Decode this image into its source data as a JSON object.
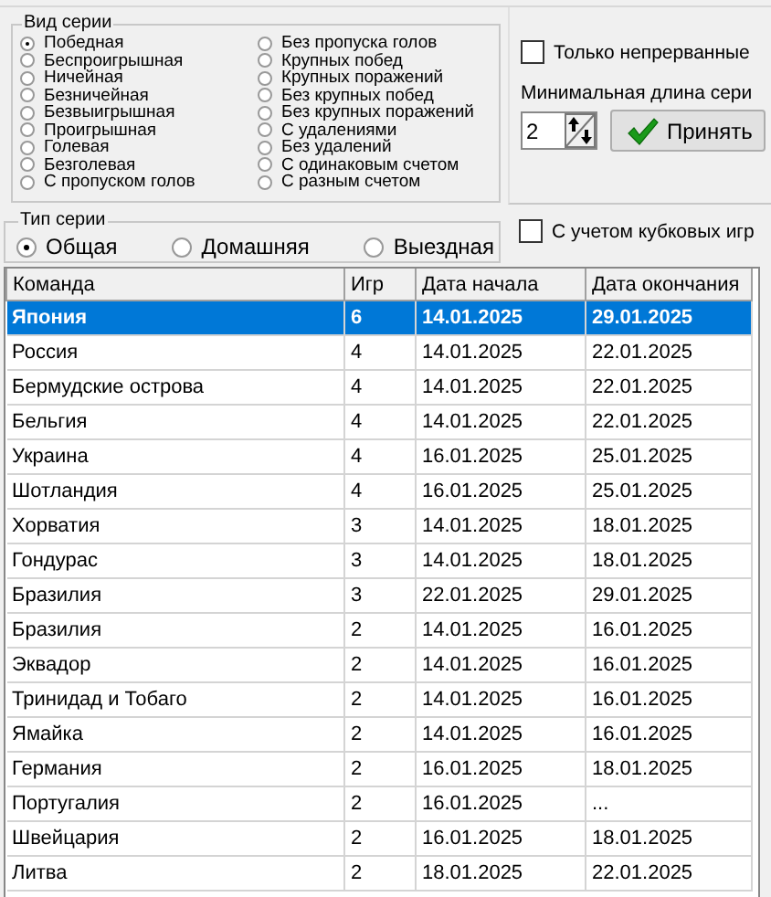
{
  "series_kind": {
    "title": "Вид серии",
    "options": [
      {
        "label": "Победная",
        "selected": true
      },
      {
        "label": "Беспроигрышная",
        "selected": false
      },
      {
        "label": "Ничейная",
        "selected": false
      },
      {
        "label": "Безничейная",
        "selected": false
      },
      {
        "label": "Безвыигрышная",
        "selected": false
      },
      {
        "label": "Проигрышная",
        "selected": false
      },
      {
        "label": "Голевая",
        "selected": false
      },
      {
        "label": "Безголевая",
        "selected": false
      },
      {
        "label": "С пропуском голов",
        "selected": false
      },
      {
        "label": "Без пропуска голов",
        "selected": false
      },
      {
        "label": "Крупных побед",
        "selected": false
      },
      {
        "label": "Крупных поражений",
        "selected": false
      },
      {
        "label": "Без крупных побед",
        "selected": false
      },
      {
        "label": "Без крупных поражений",
        "selected": false
      },
      {
        "label": "С удалениями",
        "selected": false
      },
      {
        "label": "Без удалений",
        "selected": false
      },
      {
        "label": "С одинаковым счетом",
        "selected": false
      },
      {
        "label": "С разным счетом",
        "selected": false
      }
    ]
  },
  "uninterrupted": {
    "label": "Только непрерванные",
    "checked": false
  },
  "min_length": {
    "label": "Минимальная длина сери",
    "value": "2"
  },
  "apply_button": "Принять",
  "series_type": {
    "title": "Тип серии",
    "options": [
      {
        "label": "Общая",
        "selected": true
      },
      {
        "label": "Домашняя",
        "selected": false
      },
      {
        "label": "Выездная",
        "selected": false
      }
    ]
  },
  "cup_games": {
    "label": "С учетом кубковых игр",
    "checked": false
  },
  "table": {
    "columns": [
      "Команда",
      "Игр",
      "Дата начала",
      "Дата окончания"
    ],
    "rows": [
      {
        "cells": [
          "Япония",
          "6",
          "14.01.2025",
          "29.01.2025"
        ],
        "selected": true
      },
      {
        "cells": [
          "Россия",
          "4",
          "14.01.2025",
          "22.01.2025"
        ],
        "selected": false
      },
      {
        "cells": [
          "Бермудские острова",
          "4",
          "14.01.2025",
          "22.01.2025"
        ],
        "selected": false
      },
      {
        "cells": [
          "Бельгия",
          "4",
          "14.01.2025",
          "22.01.2025"
        ],
        "selected": false
      },
      {
        "cells": [
          "Украина",
          "4",
          "16.01.2025",
          "25.01.2025"
        ],
        "selected": false
      },
      {
        "cells": [
          "Шотландия",
          "4",
          "16.01.2025",
          "25.01.2025"
        ],
        "selected": false
      },
      {
        "cells": [
          "Хорватия",
          "3",
          "14.01.2025",
          "18.01.2025"
        ],
        "selected": false
      },
      {
        "cells": [
          "Гондурас",
          "3",
          "14.01.2025",
          "18.01.2025"
        ],
        "selected": false
      },
      {
        "cells": [
          "Бразилия",
          "3",
          "22.01.2025",
          "29.01.2025"
        ],
        "selected": false
      },
      {
        "cells": [
          "Бразилия",
          "2",
          "14.01.2025",
          "16.01.2025"
        ],
        "selected": false
      },
      {
        "cells": [
          "Эквадор",
          "2",
          "14.01.2025",
          "16.01.2025"
        ],
        "selected": false
      },
      {
        "cells": [
          "Тринидад и Тобаго",
          "2",
          "14.01.2025",
          "16.01.2025"
        ],
        "selected": false
      },
      {
        "cells": [
          "Ямайка",
          "2",
          "14.01.2025",
          "16.01.2025"
        ],
        "selected": false
      },
      {
        "cells": [
          "Германия",
          "2",
          "16.01.2025",
          "18.01.2025"
        ],
        "selected": false
      },
      {
        "cells": [
          "Португалия",
          "2",
          "16.01.2025",
          "..."
        ],
        "selected": false
      },
      {
        "cells": [
          "Швейцария",
          "2",
          "16.01.2025",
          "18.01.2025"
        ],
        "selected": false
      },
      {
        "cells": [
          "Литва",
          "2",
          "18.01.2025",
          "22.01.2025"
        ],
        "selected": false
      }
    ]
  }
}
